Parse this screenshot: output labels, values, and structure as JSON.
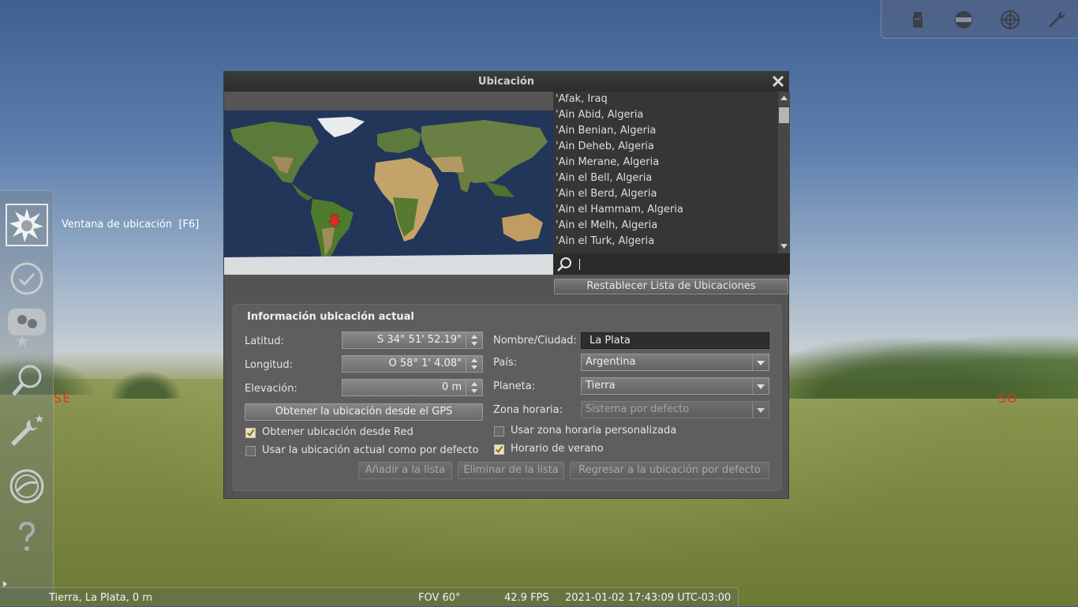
{
  "compass": {
    "southeast": "SE",
    "southwest": "SO"
  },
  "sidebar": {
    "tooltip": "Ventana de ubicación  [F6]",
    "items": [
      {
        "icon": "location-sun-icon"
      },
      {
        "icon": "clock-icon"
      },
      {
        "icon": "sky-view-icon"
      },
      {
        "icon": "search-icon"
      },
      {
        "icon": "configuration-wrench-icon"
      },
      {
        "icon": "astronomical-calculations-icon"
      },
      {
        "icon": "help-icon"
      }
    ]
  },
  "topbar": {
    "icons": [
      "telescope-eyepiece-icon",
      "ocular-view-icon",
      "reticle-icon",
      "wrench-icon"
    ]
  },
  "dialog": {
    "title": "Ubicación",
    "cities": [
      "'Afak, Iraq",
      "'Ain Abid, Algeria",
      "'Ain Benian, Algeria",
      "'Ain Deheb, Algeria",
      "'Ain Merane, Algeria",
      "'Ain el Bell, Algeria",
      "'Ain el Berd, Algeria",
      "'Ain el Hammam, Algeria",
      "'Ain el Melh, Algeria",
      "'Ain el Turk, Algeria"
    ],
    "search_value": "",
    "reset_list_label": "Restablecer Lista de Ubicaciones",
    "panel_title": "Información ubicación actual",
    "latitude_label": "Latitud:",
    "latitude_value": "S 34° 51' 52.19\"",
    "longitude_label": "Longitud:",
    "longitude_value": "O 58° 1' 4.08\"",
    "elevation_label": "Elevación:",
    "elevation_value": "0 m",
    "gps_button": "Obtener la ubicación desde el GPS",
    "network_label": "Obtener ubicación desde Red",
    "network_checked": true,
    "default_label": "Usar la ubicación actual como por defecto",
    "default_checked": false,
    "name_label": "Nombre/Ciudad:",
    "name_value": "La Plata",
    "country_label": "País:",
    "country_value": "Argentina",
    "planet_label": "Planeta:",
    "planet_value": "Tierra",
    "timezone_label": "Zona horaria:",
    "timezone_value": "Sistema por defecto",
    "custom_tz_label": "Usar zona horaria personalizada",
    "custom_tz_checked": false,
    "dst_label": "Horario de verano",
    "dst_checked": true,
    "add_button": "Añadir a la lista",
    "delete_button": "Eliminar de la lista",
    "return_button": "Regresar a la ubicación por defecto"
  },
  "statusbar": {
    "location": "Tierra, La Plata, 0 m",
    "fov": "FOV 60°",
    "fps": "42.9 FPS",
    "datetime": "2021-01-02 17:43:09 UTC-03:00"
  }
}
